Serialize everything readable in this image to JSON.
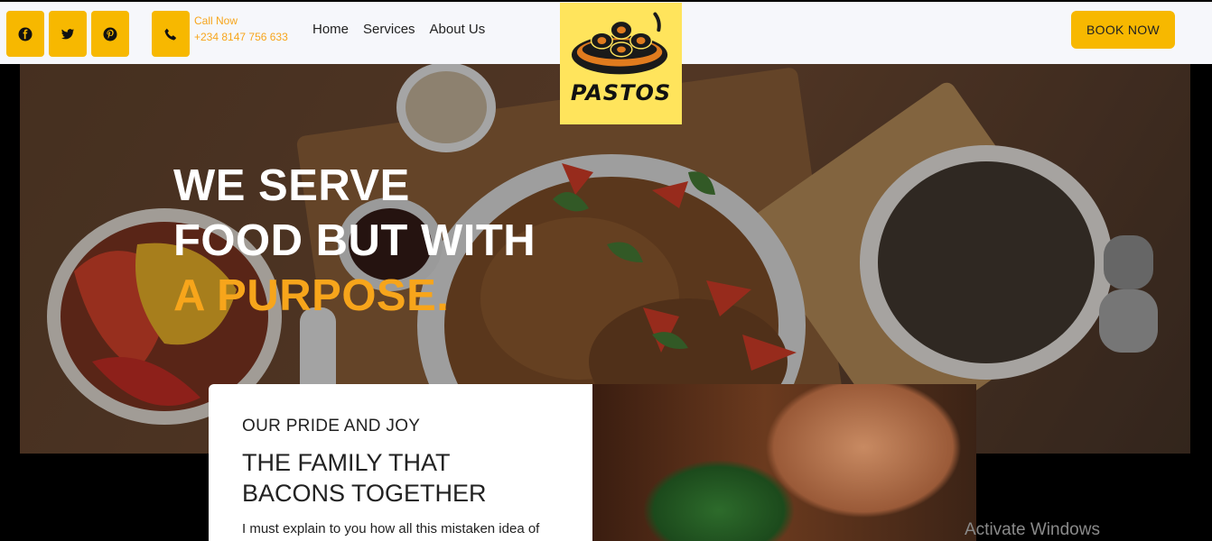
{
  "header": {
    "social": [
      "facebook-icon",
      "twitter-icon",
      "pinterest-icon"
    ],
    "call_label": "Call Now",
    "phone": "+234 8147 756 633",
    "nav": [
      "Home",
      "Services",
      "About Us"
    ],
    "book_label": "BOOK NOW",
    "logo_text": "PASTOS",
    "accent_color": "#f7b800"
  },
  "hero": {
    "line1": "WE SERVE",
    "line2": "FOOD BUT WITH",
    "line3": "A PURPOSE."
  },
  "about": {
    "kicker": "OUR PRIDE AND JOY",
    "title_line1": "THE FAMILY THAT",
    "title_line2": "BACONS TOGETHER",
    "body": "I must explain to you how all this mistaken idea of"
  },
  "system": {
    "watermark": "Activate Windows"
  }
}
